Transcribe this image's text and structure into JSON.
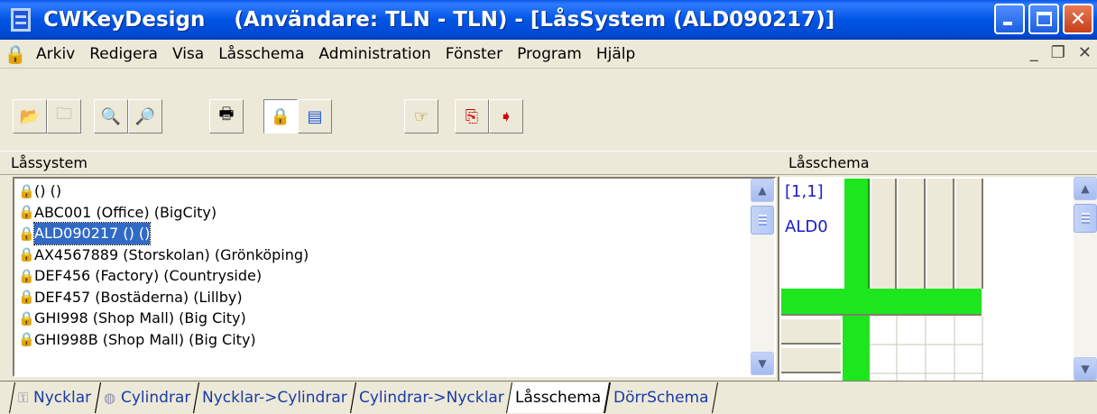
{
  "window": {
    "title": "CWKeyDesign    (Användare: TLN - TLN) - [LåsSystem (ALD090217)]",
    "min_symbol": "_",
    "max_symbol": "□",
    "close_symbol": "✕"
  },
  "menu": {
    "items": [
      "Arkiv",
      "Redigera",
      "Visa",
      "Låsschema",
      "Administration",
      "Fönster",
      "Program",
      "Hjälp"
    ],
    "mdi_min": "_",
    "mdi_restore": "❐",
    "mdi_close": "✕"
  },
  "toolbar": {
    "icons": [
      "open-folder-icon",
      "folder-icon",
      "zoom-icon",
      "zoom-in-icon",
      "print-icon",
      "lock-system-icon",
      "cylinder-icon",
      "hand-pointer-icon",
      "copy-red-icon",
      "paste-red-icon"
    ]
  },
  "left_panel": {
    "header": "Låssystem",
    "items": [
      {
        "text": "() ()",
        "selected": false
      },
      {
        "text": "ABC001 (Office) (BigCity)",
        "selected": false
      },
      {
        "text": "ALD090217 () ()",
        "selected": true
      },
      {
        "text": "AX4567889 (Storskolan) (Grönköping)",
        "selected": false
      },
      {
        "text": "DEF456 (Factory) (Countryside)",
        "selected": false
      },
      {
        "text": "DEF457 (Bostäderna) (Lillby)",
        "selected": false
      },
      {
        "text": "GHI998 (Shop Mall) (Big City)",
        "selected": false
      },
      {
        "text": "GHI998B (Shop Mall) (Big City)",
        "selected": false
      }
    ]
  },
  "right_panel": {
    "header": "Låsschema",
    "coord": "[1,1]",
    "system_label": "ALD0"
  },
  "tabs": [
    {
      "label": "Nycklar",
      "icon": "key-icon",
      "active": false
    },
    {
      "label": "Cylindrar",
      "icon": "cylinder-icon",
      "active": false
    },
    {
      "label": "Nycklar->Cylindrar",
      "icon": "",
      "active": false
    },
    {
      "label": "Cylindrar->Nycklar",
      "icon": "",
      "active": false
    },
    {
      "label": "Låsschema",
      "icon": "",
      "active": true
    },
    {
      "label": "DörrSchema",
      "icon": "",
      "active": false
    }
  ]
}
